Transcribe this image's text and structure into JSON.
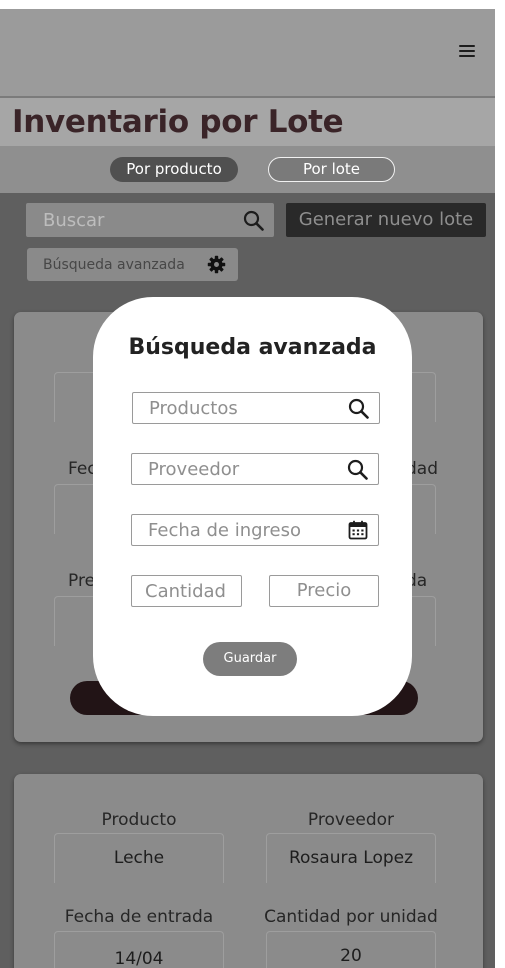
{
  "header": {
    "title": "Inventario por Lote",
    "menu_icon": "hamburger-menu-icon"
  },
  "tabs": [
    {
      "label": "Por producto"
    },
    {
      "label": "Por lote"
    }
  ],
  "toolbar": {
    "search_placeholder": "Buscar",
    "search_icon": "search-icon",
    "generate_label": "Generar nuevo lote",
    "advanced_label": "Búsqueda avanzada",
    "advanced_icon": "gear-icon"
  },
  "card1": {
    "labels": {
      "date": "Fec",
      "quantity": "dad",
      "price": "Pre",
      "right3": "da"
    }
  },
  "card2": {
    "product_label": "Producto",
    "product_value": "Leche",
    "supplier_label": "Proveedor",
    "supplier_value": "Rosaura Lopez",
    "date_label": "Fecha de entrada",
    "date_value": "14/04",
    "quantity_label": "Cantidad por unidad",
    "quantity_value": "20"
  },
  "modal": {
    "title": "Búsqueda avanzada",
    "products_placeholder": "Productos",
    "supplier_placeholder": "Proveedor",
    "date_placeholder": "Fecha de ingreso",
    "quantity_placeholder": "Cantidad",
    "price_placeholder": "Precio",
    "save_label": "Guardar"
  },
  "colors": {
    "overlay": "#5f5f5f",
    "title_color": "#3a2428",
    "modal_bg": "#ffffff",
    "save_button": "#7d7d7d"
  }
}
